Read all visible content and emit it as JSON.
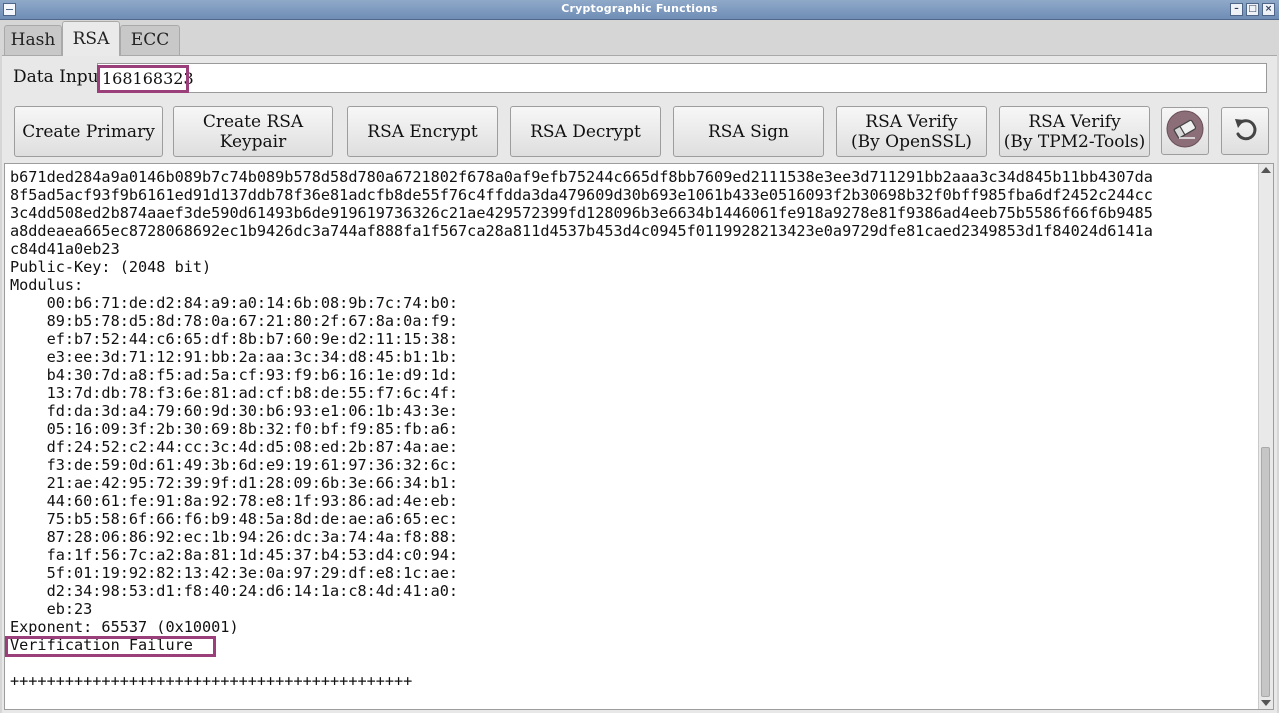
{
  "window": {
    "title": "Cryptographic Functions"
  },
  "tabs": [
    {
      "label": "Hash"
    },
    {
      "label": "RSA"
    },
    {
      "label": "ECC"
    }
  ],
  "input": {
    "label": "Data Input:",
    "value": "168168323"
  },
  "buttons": {
    "create_primary": "Create Primary",
    "create_keypair": "Create RSA Keypair",
    "encrypt": "RSA Encrypt",
    "decrypt": "RSA Decrypt",
    "sign": "RSA Sign",
    "verify_openssl": "RSA Verify\n(By OpenSSL)",
    "verify_tpm2": "RSA Verify\n(By TPM2-Tools)"
  },
  "output": {
    "lines": [
      "b671ded284a9a0146b089b7c74b089b578d58d780a6721802f678a0af9efb75244c665df8bb7609ed2111538e3ee3d711291bb2aaa3c34d845b11bb4307da",
      "8f5ad5acf93f9b6161ed91d137ddb78f36e81adcfb8de55f76c4ffdda3da479609d30b693e1061b433e0516093f2b30698b32f0bff985fba6df2452c244cc",
      "3c4dd508ed2b874aaef3de590d61493b6de919619736326c21ae429572399fd128096b3e6634b1446061fe918a9278e81f9386ad4eeb75b5586f66f6b9485",
      "a8ddeaea665ec8728068692ec1b9426dc3a744af888fa1f567ca28a811d4537b453d4c0945f0119928213423e0a9729dfe81caed2349853d1f84024d6141a",
      "c84d41a0eb23",
      "Public-Key: (2048 bit)",
      "Modulus:",
      "    00:b6:71:de:d2:84:a9:a0:14:6b:08:9b:7c:74:b0:",
      "    89:b5:78:d5:8d:78:0a:67:21:80:2f:67:8a:0a:f9:",
      "    ef:b7:52:44:c6:65:df:8b:b7:60:9e:d2:11:15:38:",
      "    e3:ee:3d:71:12:91:bb:2a:aa:3c:34:d8:45:b1:1b:",
      "    b4:30:7d:a8:f5:ad:5a:cf:93:f9:b6:16:1e:d9:1d:",
      "    13:7d:db:78:f3:6e:81:ad:cf:b8:de:55:f7:6c:4f:",
      "    fd:da:3d:a4:79:60:9d:30:b6:93:e1:06:1b:43:3e:",
      "    05:16:09:3f:2b:30:69:8b:32:f0:bf:f9:85:fb:a6:",
      "    df:24:52:c2:44:cc:3c:4d:d5:08:ed:2b:87:4a:ae:",
      "    f3:de:59:0d:61:49:3b:6d:e9:19:61:97:36:32:6c:",
      "    21:ae:42:95:72:39:9f:d1:28:09:6b:3e:66:34:b1:",
      "    44:60:61:fe:91:8a:92:78:e8:1f:93:86:ad:4e:eb:",
      "    75:b5:58:6f:66:f6:b9:48:5a:8d:de:ae:a6:65:ec:",
      "    87:28:06:86:92:ec:1b:94:26:dc:3a:74:4a:f8:88:",
      "    fa:1f:56:7c:a2:8a:81:1d:45:37:b4:53:d4:c0:94:",
      "    5f:01:19:92:82:13:42:3e:0a:97:29:df:e8:1c:ae:",
      "    d2:34:98:53:d1:f8:40:24:d6:14:1a:c8:4d:41:a0:",
      "    eb:23",
      "Exponent: 65537 (0x10001)",
      "Verification Failure",
      "",
      "++++++++++++++++++++++++++++++++++++++++++++"
    ]
  },
  "icons": {
    "clear": "eraser-icon",
    "reset": "undo-icon"
  },
  "colors": {
    "highlight": "#9b3f7a",
    "titlebar": "#7a96bd"
  }
}
